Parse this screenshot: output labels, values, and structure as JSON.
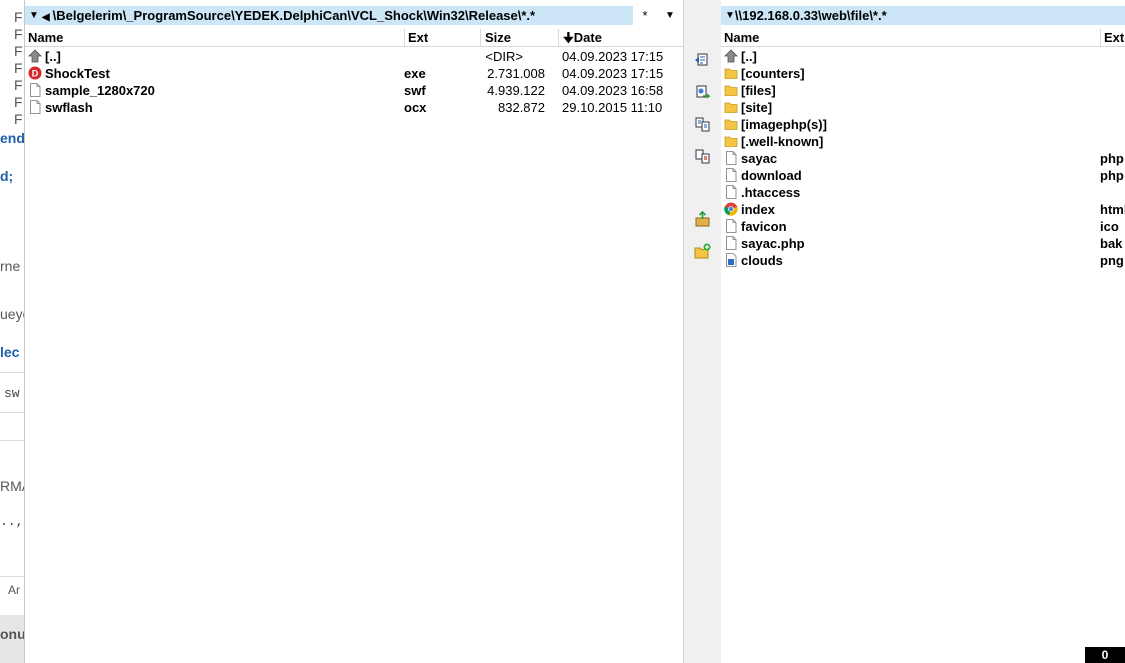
{
  "background_editor": {
    "fragments": [
      "F",
      "F",
      "F",
      "F",
      "F",
      "F",
      "F",
      "end",
      "d;",
      "rne",
      "ueyo",
      "lec",
      "sw",
      "RMA",
      "..,",
      "Ar",
      "onu"
    ]
  },
  "left_panel": {
    "path": "\\Belgelerim\\_ProgramSource\\YEDEK.DelphiCan\\VCL_Shock\\Win32\\Release\\*.*",
    "star_label": "*",
    "columns": {
      "name": "Name",
      "ext": "Ext",
      "size": "Size",
      "date": "Date"
    },
    "files": [
      {
        "icon": "up-folder-icon",
        "name": "[..]",
        "ext": "",
        "size": "<DIR>",
        "date": "04.09.2023 17:15"
      },
      {
        "icon": "delphi-exe-icon",
        "name": "ShockTest",
        "ext": "exe",
        "size": "2.731.008",
        "date": "04.09.2023 17:15"
      },
      {
        "icon": "file-icon",
        "name": "sample_1280x720",
        "ext": "swf",
        "size": "4.939.122",
        "date": "04.09.2023 16:58"
      },
      {
        "icon": "file-icon",
        "name": "swflash",
        "ext": "ocx",
        "size": "832.872",
        "date": "29.10.2015 11:10"
      }
    ]
  },
  "right_panel": {
    "path": "\\\\192.168.0.33\\web\\file\\*.*",
    "columns": {
      "name": "Name",
      "ext": "Ext"
    },
    "files": [
      {
        "icon": "up-folder-icon",
        "name": "[..]",
        "ext": ""
      },
      {
        "icon": "folder-icon",
        "name": "[counters]",
        "ext": ""
      },
      {
        "icon": "folder-icon",
        "name": "[files]",
        "ext": ""
      },
      {
        "icon": "folder-icon",
        "name": "[site]",
        "ext": ""
      },
      {
        "icon": "folder-icon",
        "name": "[imagephp(s)]",
        "ext": ""
      },
      {
        "icon": "folder-icon",
        "name": "[.well-known]",
        "ext": ""
      },
      {
        "icon": "file-icon",
        "name": "sayac",
        "ext": "php"
      },
      {
        "icon": "file-icon",
        "name": "download",
        "ext": "php"
      },
      {
        "icon": "file-icon",
        "name": ".htaccess",
        "ext": ""
      },
      {
        "icon": "chrome-icon",
        "name": "index",
        "ext": "html"
      },
      {
        "icon": "file-icon",
        "name": "favicon",
        "ext": "ico"
      },
      {
        "icon": "file-icon",
        "name": "sayac.php",
        "ext": "bak"
      },
      {
        "icon": "image-file-icon",
        "name": "clouds",
        "ext": "png"
      }
    ]
  },
  "status": {
    "count": "0"
  },
  "colors": {
    "path_bar": "#cde6f7",
    "folder": "#f4c542",
    "delphi_red": "#d9262b"
  }
}
